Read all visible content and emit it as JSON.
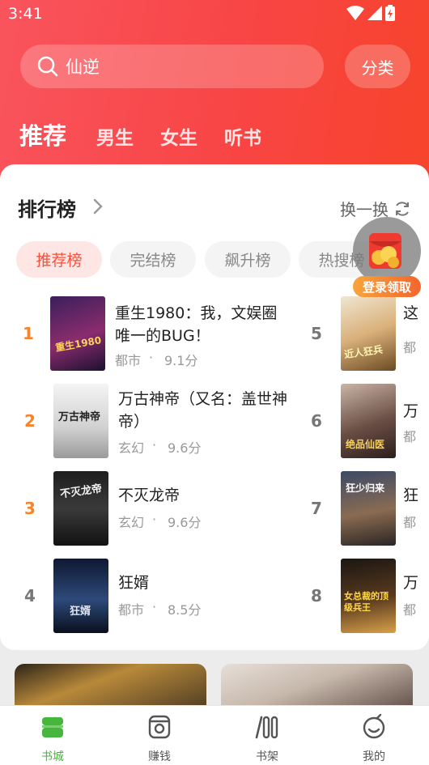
{
  "status": {
    "time": "3:41"
  },
  "search": {
    "query": "仙逆"
  },
  "category_button": "分类",
  "top_tabs": [
    "推荐",
    "男生",
    "女生",
    "听书"
  ],
  "ranking": {
    "title": "排行榜",
    "refresh_label": "换一换",
    "chips": [
      "推荐榜",
      "完结榜",
      "飙升榜",
      "热搜榜"
    ],
    "books": [
      {
        "rank": "1",
        "title_line1": "重生1980：我，文娱圈",
        "title_line2": "唯一的BUG！",
        "genre": "都市",
        "score": "9.1分"
      },
      {
        "rank": "2",
        "title_line1": "万古神帝（又名：盖世神",
        "title_line2": "帝）",
        "genre": "玄幻",
        "score": "9.6分"
      },
      {
        "rank": "3",
        "title_line1": "不灭龙帝",
        "title_line2": "",
        "genre": "玄幻",
        "score": "9.6分"
      },
      {
        "rank": "4",
        "title_line1": "狂婿",
        "title_line2": "",
        "genre": "都市",
        "score": "8.5分"
      }
    ],
    "side_ranks": [
      "5",
      "6",
      "7",
      "8"
    ],
    "side_title_chars": [
      "这",
      "万",
      "狂",
      "万"
    ],
    "side_meta_chars": [
      "都",
      "都",
      "都",
      "都"
    ],
    "sep": "·",
    "cover_texts": [
      "重生1980",
      "万古神帝",
      "不灭龙帝",
      "狂婿",
      "近人狂兵",
      "绝品仙医",
      "狂少归来",
      "女总裁的顶级兵王"
    ]
  },
  "promo_badge": "登录领取",
  "bottom_nav": [
    {
      "label": "书城",
      "icon": "bookstore-icon"
    },
    {
      "label": "赚钱",
      "icon": "wallet-icon"
    },
    {
      "label": "书架",
      "icon": "bookshelf-icon"
    },
    {
      "label": "我的",
      "icon": "profile-icon"
    }
  ],
  "colors": {
    "brand_red": "#f84545",
    "accent_orange": "#f7842c",
    "nav_active": "#46b63c"
  }
}
